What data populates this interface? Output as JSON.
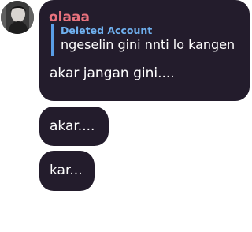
{
  "message_group": {
    "sender_name": "olaaa",
    "avatar_icon": "user-avatar-photo",
    "colors": {
      "bubble_background": "#231c2c",
      "sender_name": "#e9727d",
      "reply_author": "#6fb0ef",
      "reply_bar": "#5a9ee7",
      "message_text": "#ffffff"
    },
    "messages": [
      {
        "reply": {
          "author": "Deleted Account",
          "text": "ngeselin gini nnti lo kangen"
        },
        "text": "akar jangan gini...."
      },
      {
        "text": "akar...."
      },
      {
        "text": "kar..."
      }
    ]
  }
}
